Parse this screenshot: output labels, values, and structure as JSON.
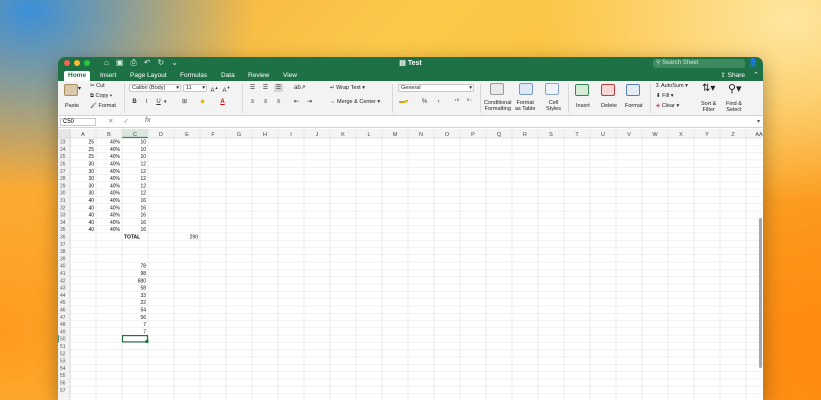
{
  "titlebar": {
    "doc_title": "Test",
    "search_placeholder": "Search Sheet"
  },
  "tabs": [
    "Home",
    "Insert",
    "Page Layout",
    "Formulas",
    "Data",
    "Review",
    "View"
  ],
  "share_label": "Share",
  "ribbon": {
    "paste": "Paste",
    "cut": "Cut",
    "copy": "Copy",
    "format": "Format",
    "font_name": "Calibri (Body)",
    "font_size": "11",
    "bold": "B",
    "italic": "I",
    "underline": "U",
    "wrap_text": "Wrap Text",
    "merge_center": "Merge & Center",
    "number_format": "General",
    "percent": "%",
    "comma": "‹",
    "conditional_formatting": [
      "Conditional",
      "Formatting"
    ],
    "format_as_table": [
      "Format",
      "as Table"
    ],
    "cell_styles": [
      "Cell",
      "Styles"
    ],
    "insert": "Insert",
    "delete": "Delete",
    "format_cells": "Format",
    "autosum": "AutoSum",
    "fill": "Fill",
    "clear": "Clear",
    "sort_filter": [
      "Sort &",
      "Filter"
    ],
    "find_select": [
      "Find &",
      "Select"
    ]
  },
  "formula_bar": {
    "name_box": "C50",
    "fx": "fx"
  },
  "sheet": {
    "columns": [
      "A",
      "B",
      "C",
      "D",
      "E",
      "F",
      "G",
      "H",
      "I",
      "J",
      "K",
      "L",
      "M",
      "N",
      "O",
      "P",
      "Q",
      "R",
      "S",
      "T",
      "U",
      "V",
      "W",
      "X",
      "Y",
      "Z",
      "AA"
    ],
    "selected_column": "C",
    "selected_cell": {
      "row": 50,
      "col": "C"
    },
    "rows": [
      {
        "n": 23,
        "A": "25",
        "B": "40%",
        "C": "10"
      },
      {
        "n": 24,
        "A": "25",
        "B": "40%",
        "C": "10"
      },
      {
        "n": 25,
        "A": "25",
        "B": "40%",
        "C": "10"
      },
      {
        "n": 26,
        "A": "30",
        "B": "40%",
        "C": "12"
      },
      {
        "n": 27,
        "A": "30",
        "B": "40%",
        "C": "12"
      },
      {
        "n": 28,
        "A": "30",
        "B": "40%",
        "C": "12"
      },
      {
        "n": 29,
        "A": "30",
        "B": "40%",
        "C": "12"
      },
      {
        "n": 30,
        "A": "30",
        "B": "40%",
        "C": "12"
      },
      {
        "n": 31,
        "A": "40",
        "B": "40%",
        "C": "16"
      },
      {
        "n": 32,
        "A": "40",
        "B": "40%",
        "C": "16"
      },
      {
        "n": 33,
        "A": "40",
        "B": "40%",
        "C": "16"
      },
      {
        "n": 34,
        "A": "40",
        "B": "40%",
        "C": "16"
      },
      {
        "n": 35,
        "A": "40",
        "B": "40%",
        "C": "16"
      },
      {
        "n": 36,
        "C": "TOTAL",
        "E": "290"
      },
      {
        "n": 37
      },
      {
        "n": 38
      },
      {
        "n": 39
      },
      {
        "n": 40,
        "C": "78"
      },
      {
        "n": 41,
        "C": "98"
      },
      {
        "n": 42,
        "C": "680"
      },
      {
        "n": 43,
        "C": "58"
      },
      {
        "n": 44,
        "C": "33"
      },
      {
        "n": 45,
        "C": "22"
      },
      {
        "n": 46,
        "C": "54"
      },
      {
        "n": 47,
        "C": "56"
      },
      {
        "n": 48,
        "C": "7"
      },
      {
        "n": 49,
        "C": "7"
      },
      {
        "n": 50
      },
      {
        "n": 51
      },
      {
        "n": 52
      },
      {
        "n": 53
      },
      {
        "n": 54
      },
      {
        "n": 55
      },
      {
        "n": 56
      },
      {
        "n": 57
      }
    ]
  }
}
